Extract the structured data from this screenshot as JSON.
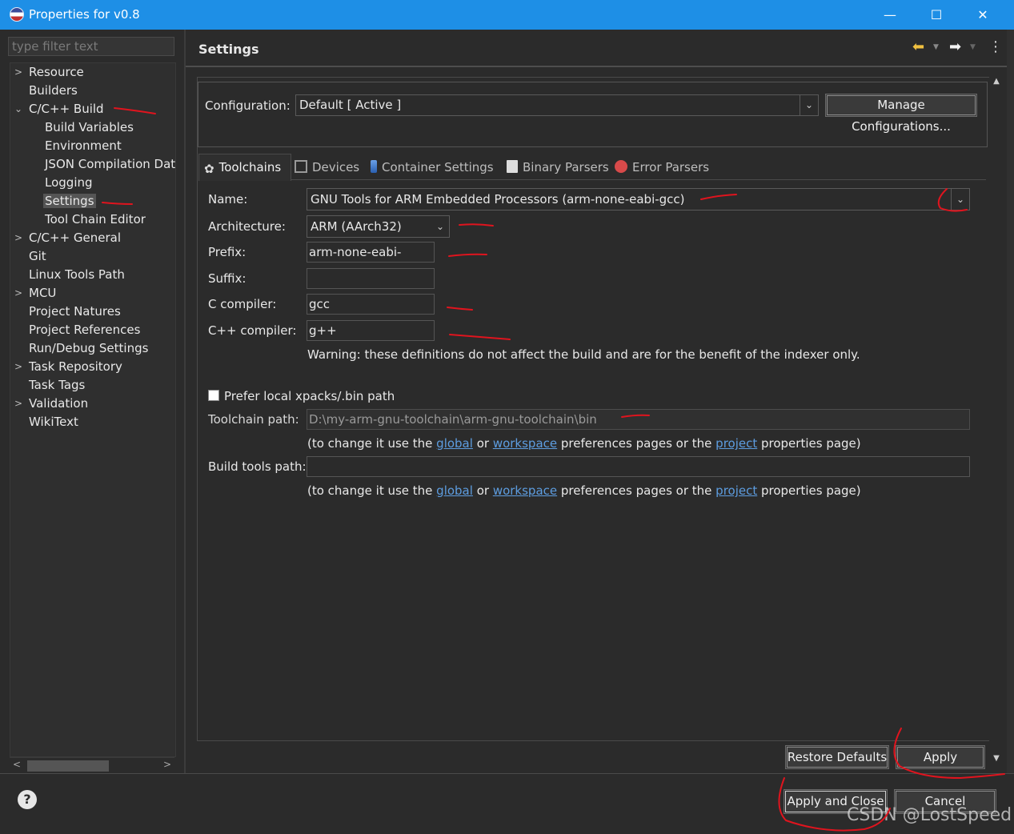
{
  "window": {
    "title": "Properties for v0.8",
    "minimize": "—",
    "maximize": "☐",
    "close": "✕"
  },
  "filter": {
    "placeholder": "type filter text"
  },
  "tree": {
    "items": [
      {
        "label": "Resource",
        "expandable": true
      },
      {
        "label": "Builders"
      },
      {
        "label": "C/C++ Build",
        "expanded": true
      },
      {
        "label": "Build Variables"
      },
      {
        "label": "Environment"
      },
      {
        "label": "JSON Compilation Dat"
      },
      {
        "label": "Logging"
      },
      {
        "label": "Settings",
        "selected": true
      },
      {
        "label": "Tool Chain Editor"
      },
      {
        "label": "C/C++ General",
        "expandable": true
      },
      {
        "label": "Git"
      },
      {
        "label": "Linux Tools Path"
      },
      {
        "label": "MCU",
        "expandable": true
      },
      {
        "label": "Project Natures"
      },
      {
        "label": "Project References"
      },
      {
        "label": "Run/Debug Settings"
      },
      {
        "label": "Task Repository",
        "expandable": true
      },
      {
        "label": "Task Tags"
      },
      {
        "label": "Validation",
        "expandable": true
      },
      {
        "label": "WikiText"
      }
    ]
  },
  "page": {
    "title": "Settings"
  },
  "configuration": {
    "label": "Configuration:",
    "value": "Default  [ Active ]",
    "manage_button": "Manage Configurations..."
  },
  "tabs": [
    {
      "label": "Toolchains",
      "active": true
    },
    {
      "label": "Devices"
    },
    {
      "label": "Container Settings"
    },
    {
      "label": "Binary Parsers"
    },
    {
      "label": "Error Parsers"
    }
  ],
  "toolchain": {
    "name_label": "Name:",
    "name_value": "GNU Tools for ARM Embedded Processors (arm-none-eabi-gcc)",
    "arch_label": "Architecture:",
    "arch_value": "ARM (AArch32)",
    "prefix_label": "Prefix:",
    "prefix_value": "arm-none-eabi-",
    "suffix_label": "Suffix:",
    "suffix_value": "",
    "c_label": "C compiler:",
    "c_value": "gcc",
    "cpp_label": "C++ compiler:",
    "cpp_value": "g++",
    "warning": "Warning: these definitions do not affect the build and are for the benefit of the indexer only.",
    "prefer_local_label": "Prefer local xpacks/.bin path",
    "prefer_local_checked": false,
    "toolchain_path_label": "Toolchain path:",
    "toolchain_path_value": "D:\\my-arm-gnu-toolchain\\arm-gnu-toolchain\\bin",
    "build_tools_path_label": "Build tools path:",
    "build_tools_path_value": ""
  },
  "hint": {
    "prefix": "(to change it use the ",
    "global": "global",
    "or": " or ",
    "workspace": "workspace",
    "middle": " preferences pages or the ",
    "project": "project",
    "suffix": " properties page)"
  },
  "buttons": {
    "restore_defaults": "Restore Defaults",
    "apply": "Apply",
    "apply_and_close": "Apply and Close",
    "cancel": "Cancel"
  },
  "watermark": "CSDN @LostSpeed",
  "colors": {
    "titlebar": "#1e8fe6",
    "background": "#2b2b2b",
    "link": "#5d9de0",
    "annotation": "#e0141e"
  }
}
